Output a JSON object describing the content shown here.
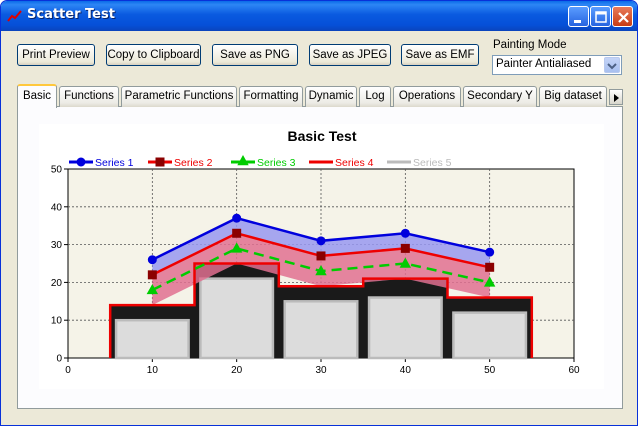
{
  "window": {
    "title": "Scatter Test",
    "minimize": "minimize",
    "maximize": "maximize",
    "close": "close"
  },
  "toolbar": {
    "print_preview": "Print Preview",
    "copy_clipboard": "Copy to Clipboard",
    "save_png": "Save as PNG",
    "save_jpeg": "Save as JPEG",
    "save_emf": "Save as EMF",
    "painting_mode_label": "Painting Mode",
    "painting_mode_value": "Painter Antialiased"
  },
  "tabs": [
    {
      "label": "Basic",
      "active": true
    },
    {
      "label": "Functions"
    },
    {
      "label": "Parametric Functions"
    },
    {
      "label": "Formatting"
    },
    {
      "label": "Dynamic"
    },
    {
      "label": "Log"
    },
    {
      "label": "Operations"
    },
    {
      "label": "Secondary Y"
    },
    {
      "label": "Big dataset"
    }
  ],
  "colors": {
    "series1": "#0000dd",
    "series2": "#ee0000",
    "series3": "#00cc00",
    "series4": "#ee0000",
    "series5": "#bbbbbb",
    "marker2": "#8b0000",
    "plot_bg": "#f5f3e8"
  },
  "chart_data": {
    "type": "scatter",
    "title": "Basic Test",
    "xlim": [
      0,
      60
    ],
    "ylim": [
      0,
      50
    ],
    "xticks": [
      0,
      10,
      20,
      30,
      40,
      50,
      60
    ],
    "yticks": [
      0,
      10,
      20,
      30,
      40,
      50
    ],
    "grid": true,
    "legend": "top-left",
    "series": [
      {
        "name": "Series 1",
        "x": [
          10,
          20,
          30,
          40,
          50
        ],
        "y": [
          26,
          37,
          31,
          33,
          28
        ]
      },
      {
        "name": "Series 2",
        "x": [
          10,
          20,
          30,
          40,
          50
        ],
        "y": [
          22,
          33,
          27,
          29,
          24
        ]
      },
      {
        "name": "Series 3",
        "x": [
          10,
          20,
          30,
          40,
          50
        ],
        "y": [
          18,
          29,
          23,
          25,
          20
        ]
      },
      {
        "name": "Series 4",
        "x": [
          10,
          20,
          30,
          40,
          50
        ],
        "y": [
          14,
          25,
          19,
          21,
          16
        ]
      },
      {
        "name": "Series 5",
        "x": [
          10,
          20,
          30,
          40,
          50
        ],
        "y": [
          10,
          21,
          15,
          16,
          12
        ]
      }
    ]
  }
}
